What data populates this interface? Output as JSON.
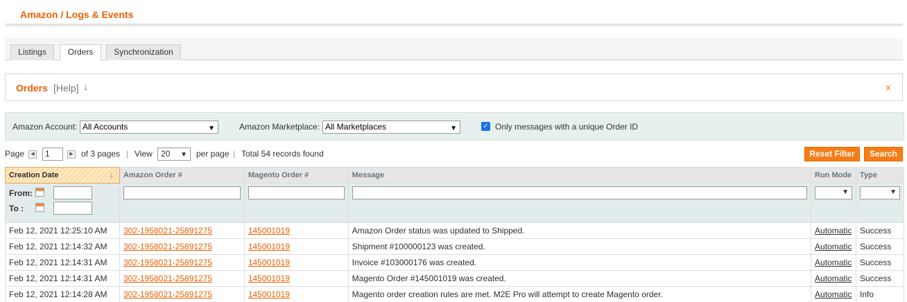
{
  "page": {
    "title": "Amazon / Logs & Events"
  },
  "tabs": [
    {
      "label": "Listings"
    },
    {
      "label": "Orders"
    },
    {
      "label": "Synchronization"
    }
  ],
  "help_box": {
    "title": "Orders",
    "help_link": "[Help]",
    "arrow": "↓",
    "close": "x"
  },
  "filters": {
    "account_label": "Amazon Account:",
    "account_value": "All Accounts",
    "marketplace_label": "Amazon Marketplace:",
    "marketplace_value": "All Marketplaces",
    "unique_label": "Only messages with a unique Order ID",
    "unique_checked": true
  },
  "pager": {
    "page_label": "Page",
    "page_value": "1",
    "of_pages": "of 3 pages",
    "view_label": "View",
    "per_page_value": "20",
    "per_page_label": "per page",
    "total": "Total 54 records found",
    "sep": "|"
  },
  "buttons": {
    "reset": "Reset Filter",
    "search": "Search"
  },
  "columns": [
    "Creation Date",
    "Amazon Order #",
    "Magento Order #",
    "Message",
    "Run Mode",
    "Type"
  ],
  "date_filter": {
    "from": "From:",
    "to": "To :"
  },
  "rows": [
    {
      "date": "Feb 12, 2021 12:25:10 AM",
      "amazon": "302-1958021-25891275",
      "magento": "145001019",
      "message": "Amazon Order status was updated to Shipped.",
      "mode": "Automatic",
      "type": "Success"
    },
    {
      "date": "Feb 12, 2021 12:14:32 AM",
      "amazon": "302-1958021-25891275",
      "magento": "145001019",
      "message": "Shipment #100000123 was created.",
      "mode": "Automatic",
      "type": "Success"
    },
    {
      "date": "Feb 12, 2021 12:14:31 AM",
      "amazon": "302-1958021-25891275",
      "magento": "145001019",
      "message": "Invoice #103000176 was created.",
      "mode": "Automatic",
      "type": "Success"
    },
    {
      "date": "Feb 12, 2021 12:14:31 AM",
      "amazon": "302-1958021-25891275",
      "magento": "145001019",
      "message": "Magento Order #145001019 was created.",
      "mode": "Automatic",
      "type": "Success"
    },
    {
      "date": "Feb 12, 2021 12:14:28 AM",
      "amazon": "302-1958021-25891275",
      "magento": "145001019",
      "message": "Magento order creation rules are met. M2E Pro will attempt to create Magento order.",
      "mode": "Automatic",
      "type": "Info"
    }
  ],
  "colors": {
    "accent": "#eb5e00",
    "button": "#f77c16",
    "success": "#3d8d19"
  }
}
